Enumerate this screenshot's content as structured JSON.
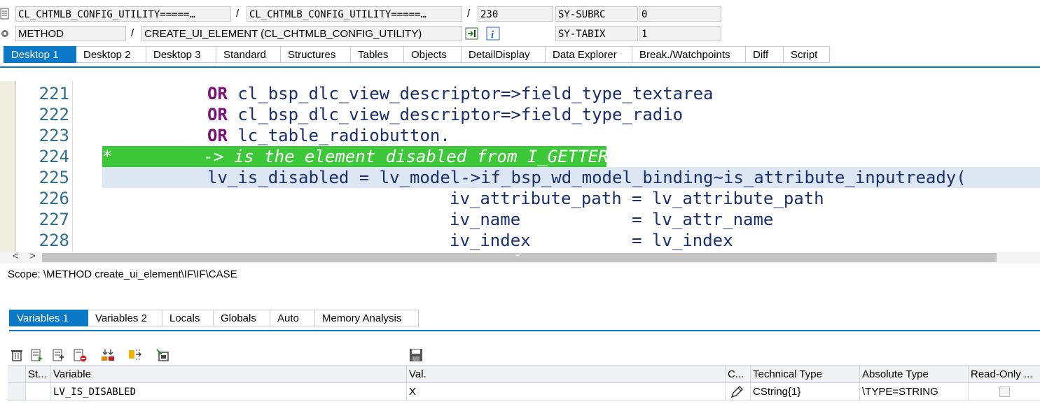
{
  "header": {
    "row1": {
      "program": "CL_CHTMLB_CONFIG_UTILITY=====…",
      "sep1": "/",
      "include": "CL_CHTMLB_CONFIG_UTILITY=====…",
      "sep2": "/",
      "line": "230",
      "sysfield_name": "SY-SUBRC",
      "sysfield_value": "0"
    },
    "row2": {
      "event_type": "METHOD",
      "sep1": "/",
      "event_name": "CREATE_UI_ELEMENT (CL_CHTMLB_CONFIG_UTILITY)",
      "sysfield_name": "SY-TABIX",
      "sysfield_value": "1"
    }
  },
  "top_tabs": [
    "Desktop 1",
    "Desktop 2",
    "Desktop 3",
    "Standard",
    "Structures",
    "Tables",
    "Objects",
    "DetailDisplay",
    "Data Explorer",
    "Break./Watchpoints",
    "Diff",
    "Script"
  ],
  "editor": {
    "lines": [
      {
        "n": "221",
        "kw": "OR",
        "text": " cl_bsp_dlc_view_descriptor=>field_type_textarea"
      },
      {
        "n": "222",
        "kw": "OR",
        "text": " cl_bsp_dlc_view_descriptor=>field_type_radio"
      },
      {
        "n": "223",
        "kw": "OR",
        "text": " lc_table_radiobutton."
      },
      {
        "n": "224",
        "comment": "*         -> is the element disabled from I_GETTER"
      },
      {
        "n": "225",
        "text": "lv_is_disabled = lv_model->if_bsp_wd_model_binding~is_attribute_inputready("
      },
      {
        "n": "226",
        "text": "iv_attribute_path = lv_attribute_path"
      },
      {
        "n": "227",
        "text": "iv_name           = lv_attr_name"
      },
      {
        "n": "228",
        "text": "iv_index          = lv_index"
      }
    ],
    "scroll_left": "<",
    "scroll_right": ">",
    "scroll_grip": "≡"
  },
  "scope": "Scope: \\METHOD create_ui_element\\IF\\IF\\CASE",
  "var_tabs": [
    "Variables 1",
    "Variables 2",
    "Locals",
    "Globals",
    "Auto",
    "Memory Analysis"
  ],
  "toolbar_icons": [
    "delete-icon",
    "insert-row-icon",
    "append-row-icon",
    "delete-row-icon",
    "settings-icon",
    "move-icon",
    "export-icon",
    "save-icon"
  ],
  "grid": {
    "headers": [
      "St...",
      "Variable",
      "Val.",
      "C...",
      "Technical Type",
      "Absolute Type",
      "Read-Only ..."
    ],
    "rows": [
      {
        "status": "",
        "variable": "LV_IS_DISABLED",
        "value": "X",
        "change": "pencil-icon",
        "technical_type": "CString{1}",
        "absolute_type": "\\TYPE=STRING",
        "read_only": false
      }
    ]
  },
  "colors": {
    "accent": "#0a7ac8",
    "keyword": "#7a0f7a",
    "comment_bg": "#3cc838",
    "current_line_bg": "#dde7f3",
    "identifier": "#1a2f6e"
  }
}
